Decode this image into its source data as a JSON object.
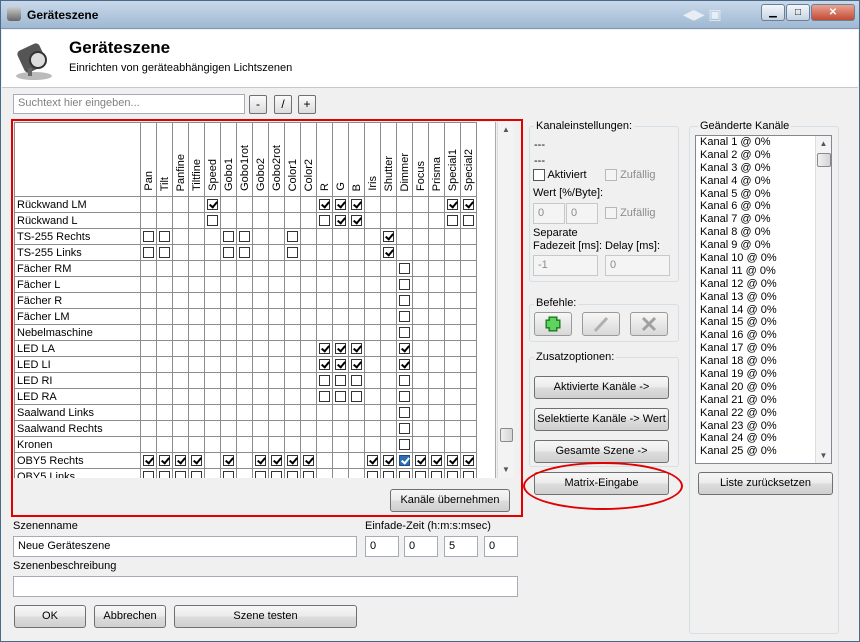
{
  "window": {
    "title": "Geräteszene"
  },
  "header": {
    "title": "Geräteszene",
    "subtitle": "Einrichten von geräteabhängigen Lichtszenen"
  },
  "search": {
    "placeholder": "Suchtext hier eingeben...",
    "minus": "-",
    "slash": "/",
    "plus": "+"
  },
  "grid": {
    "columns": [
      "Pan",
      "Tilt",
      "Panfine",
      "Tiltfine",
      "Speed",
      "Gobo1",
      "Gobo1rot",
      "Gobo2",
      "Gobo2rot",
      "Color1",
      "Color2",
      "R",
      "G",
      "B",
      "Iris",
      "Shutter",
      "Dimmer",
      "Focus",
      "Prisma",
      "Special1",
      "Special2"
    ],
    "rows": [
      {
        "name": "Rückwand LM",
        "checks": [
          "",
          "",
          "",
          "",
          "1",
          "",
          "",
          "",
          "",
          "",
          "",
          "1",
          "1",
          "1",
          "",
          "",
          "",
          "",
          "",
          "1",
          "1"
        ]
      },
      {
        "name": "Rückwand L",
        "checks": [
          "",
          "",
          "",
          "",
          "0",
          "",
          "",
          "",
          "",
          "",
          "",
          "0",
          "1",
          "1",
          "",
          "",
          "",
          "",
          "",
          "0",
          "0"
        ]
      },
      {
        "name": "TS-255 Rechts",
        "checks": [
          "0",
          "0",
          "",
          "",
          "",
          "0",
          "0",
          "",
          "",
          "0",
          "",
          "",
          "",
          "",
          "",
          "1",
          "",
          "",
          "",
          "",
          ""
        ]
      },
      {
        "name": "TS-255 Links",
        "checks": [
          "0",
          "0",
          "",
          "",
          "",
          "0",
          "0",
          "",
          "",
          "0",
          "",
          "",
          "",
          "",
          "",
          "1",
          "",
          "",
          "",
          "",
          ""
        ]
      },
      {
        "name": "Fächer RM",
        "checks": [
          "",
          "",
          "",
          "",
          "",
          "",
          "",
          "",
          "",
          "",
          "",
          "",
          "",
          "",
          "",
          "",
          "0",
          "",
          "",
          "",
          ""
        ]
      },
      {
        "name": "Fächer L",
        "checks": [
          "",
          "",
          "",
          "",
          "",
          "",
          "",
          "",
          "",
          "",
          "",
          "",
          "",
          "",
          "",
          "",
          "0",
          "",
          "",
          "",
          ""
        ]
      },
      {
        "name": "Fächer R",
        "checks": [
          "",
          "",
          "",
          "",
          "",
          "",
          "",
          "",
          "",
          "",
          "",
          "",
          "",
          "",
          "",
          "",
          "0",
          "",
          "",
          "",
          ""
        ]
      },
      {
        "name": "Fächer LM",
        "checks": [
          "",
          "",
          "",
          "",
          "",
          "",
          "",
          "",
          "",
          "",
          "",
          "",
          "",
          "",
          "",
          "",
          "0",
          "",
          "",
          "",
          ""
        ]
      },
      {
        "name": "Nebelmaschine",
        "checks": [
          "",
          "",
          "",
          "",
          "",
          "",
          "",
          "",
          "",
          "",
          "",
          "",
          "",
          "",
          "",
          "",
          "0",
          "",
          "",
          "",
          ""
        ]
      },
      {
        "name": "LED LA",
        "checks": [
          "",
          "",
          "",
          "",
          "",
          "",
          "",
          "",
          "",
          "",
          "",
          "1",
          "1",
          "1",
          "",
          "",
          "1",
          "",
          "",
          "",
          ""
        ]
      },
      {
        "name": "LED LI",
        "checks": [
          "",
          "",
          "",
          "",
          "",
          "",
          "",
          "",
          "",
          "",
          "",
          "1",
          "1",
          "1",
          "",
          "",
          "1",
          "",
          "",
          "",
          ""
        ]
      },
      {
        "name": "LED RI",
        "checks": [
          "",
          "",
          "",
          "",
          "",
          "",
          "",
          "",
          "",
          "",
          "",
          "0",
          "0",
          "0",
          "",
          "",
          "0",
          "",
          "",
          "",
          ""
        ]
      },
      {
        "name": "LED RA",
        "checks": [
          "",
          "",
          "",
          "",
          "",
          "",
          "",
          "",
          "",
          "",
          "",
          "0",
          "0",
          "0",
          "",
          "",
          "0",
          "",
          "",
          "",
          ""
        ]
      },
      {
        "name": "Saalwand Links",
        "checks": [
          "",
          "",
          "",
          "",
          "",
          "",
          "",
          "",
          "",
          "",
          "",
          "",
          "",
          "",
          "",
          "",
          "0",
          "",
          "",
          "",
          ""
        ]
      },
      {
        "name": "Saalwand Rechts",
        "checks": [
          "",
          "",
          "",
          "",
          "",
          "",
          "",
          "",
          "",
          "",
          "",
          "",
          "",
          "",
          "",
          "",
          "0",
          "",
          "",
          "",
          ""
        ]
      },
      {
        "name": "Kronen",
        "checks": [
          "",
          "",
          "",
          "",
          "",
          "",
          "",
          "",
          "",
          "",
          "",
          "",
          "",
          "",
          "",
          "",
          "0",
          "",
          "",
          "",
          ""
        ]
      },
      {
        "name": "OBY5 Rechts",
        "checks": [
          "1",
          "1",
          "1",
          "1",
          "",
          "1",
          "",
          "1",
          "1",
          "1",
          "1",
          "",
          "",
          "",
          "1",
          "1",
          "S",
          "1",
          "1",
          "1",
          "1"
        ]
      },
      {
        "name": "OBY5 Links",
        "checks": [
          "0",
          "0",
          "0",
          "0",
          "",
          "0",
          "",
          "0",
          "0",
          "0",
          "0",
          "",
          "",
          "",
          "0",
          "0",
          "0",
          "0",
          "0",
          "0",
          "0"
        ]
      }
    ],
    "apply_button": "Kanäle übernehmen"
  },
  "form": {
    "scene_name_label": "Szenenname",
    "scene_name_value": "Neue Geräteszene",
    "fade_label": "Einfade-Zeit (h:m:s:msec)",
    "fade_h": "0",
    "fade_m": "0",
    "fade_s": "5",
    "fade_ms": "0",
    "desc_label": "Szenenbeschreibung",
    "desc_value": "",
    "ok": "OK",
    "cancel": "Abbrechen",
    "test": "Szene testen"
  },
  "channel_settings": {
    "title": "Kanaleinstellungen:",
    "line1": "---",
    "line2": "---",
    "aktiviert": "Aktiviert",
    "zufaellig": "Zufällig",
    "wert_label": "Wert [%/Byte]:",
    "wert1": "0",
    "wert2": "0",
    "zufaellig2": "Zufällig",
    "separate": "Separate",
    "fadezeit_label": "Fadezeit [ms]:",
    "delay_label": "Delay [ms]:",
    "fadezeit_value": "-1",
    "delay_value": "0"
  },
  "commands": {
    "title": "Befehle:"
  },
  "options": {
    "title": "Zusatzoptionen:",
    "activated": "Aktivierte Kanäle ->",
    "selected": "Selektierte Kanäle -> Wert",
    "whole": "Gesamte Szene ->",
    "matrix": "Matrix-Eingabe"
  },
  "changed": {
    "title": "Geänderte Kanäle",
    "items": [
      "Kanal 1 @ 0%",
      "Kanal 2 @ 0%",
      "Kanal 3 @ 0%",
      "Kanal 4 @ 0%",
      "Kanal 5 @ 0%",
      "Kanal 6 @ 0%",
      "Kanal 7 @ 0%",
      "Kanal 8 @ 0%",
      "Kanal 9 @ 0%",
      "Kanal 10 @ 0%",
      "Kanal 11 @ 0%",
      "Kanal 12 @ 0%",
      "Kanal 13 @ 0%",
      "Kanal 14 @ 0%",
      "Kanal 15 @ 0%",
      "Kanal 16 @ 0%",
      "Kanal 17 @ 0%",
      "Kanal 18 @ 0%",
      "Kanal 19 @ 0%",
      "Kanal 20 @ 0%",
      "Kanal 21 @ 0%",
      "Kanal 22 @ 0%",
      "Kanal 23 @ 0%",
      "Kanal 24 @ 0%",
      "Kanal 25 @ 0%"
    ],
    "reset": "Liste zurücksetzen"
  }
}
